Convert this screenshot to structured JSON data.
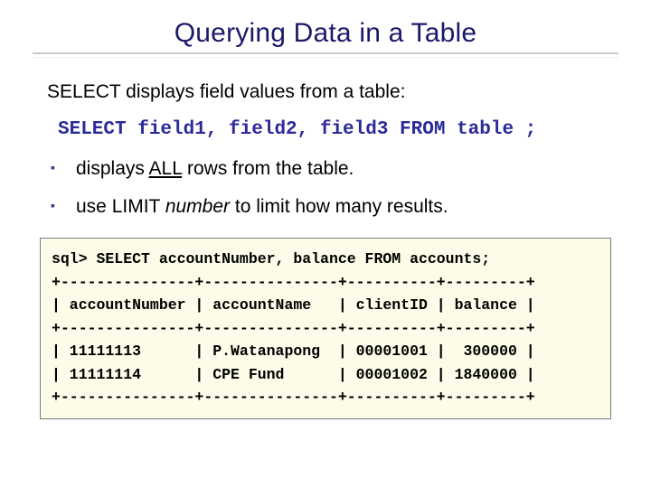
{
  "title": "Querying Data in a Table",
  "intro": "SELECT displays field values from a table:",
  "select_stmt": "SELECT field1, field2, field3 FROM table ;",
  "bullets": [
    {
      "pre": "displays ",
      "u": "ALL",
      "post": " rows from the table."
    },
    {
      "pre": "use LIMIT ",
      "i": "number",
      "post": " to limit how many results."
    }
  ],
  "sql_box": {
    "prompt": "sql> SELECT accountNumber, balance FROM accounts;",
    "border": "+---------------+---------------+----------+---------+",
    "header": "| accountNumber | accountName   | clientID | balance |",
    "rows": [
      "| 11111113      | P.Watanapong  | 00001001 |  300000 |",
      "| 11111114      | CPE Fund      | 00001002 | 1840000 |"
    ]
  }
}
